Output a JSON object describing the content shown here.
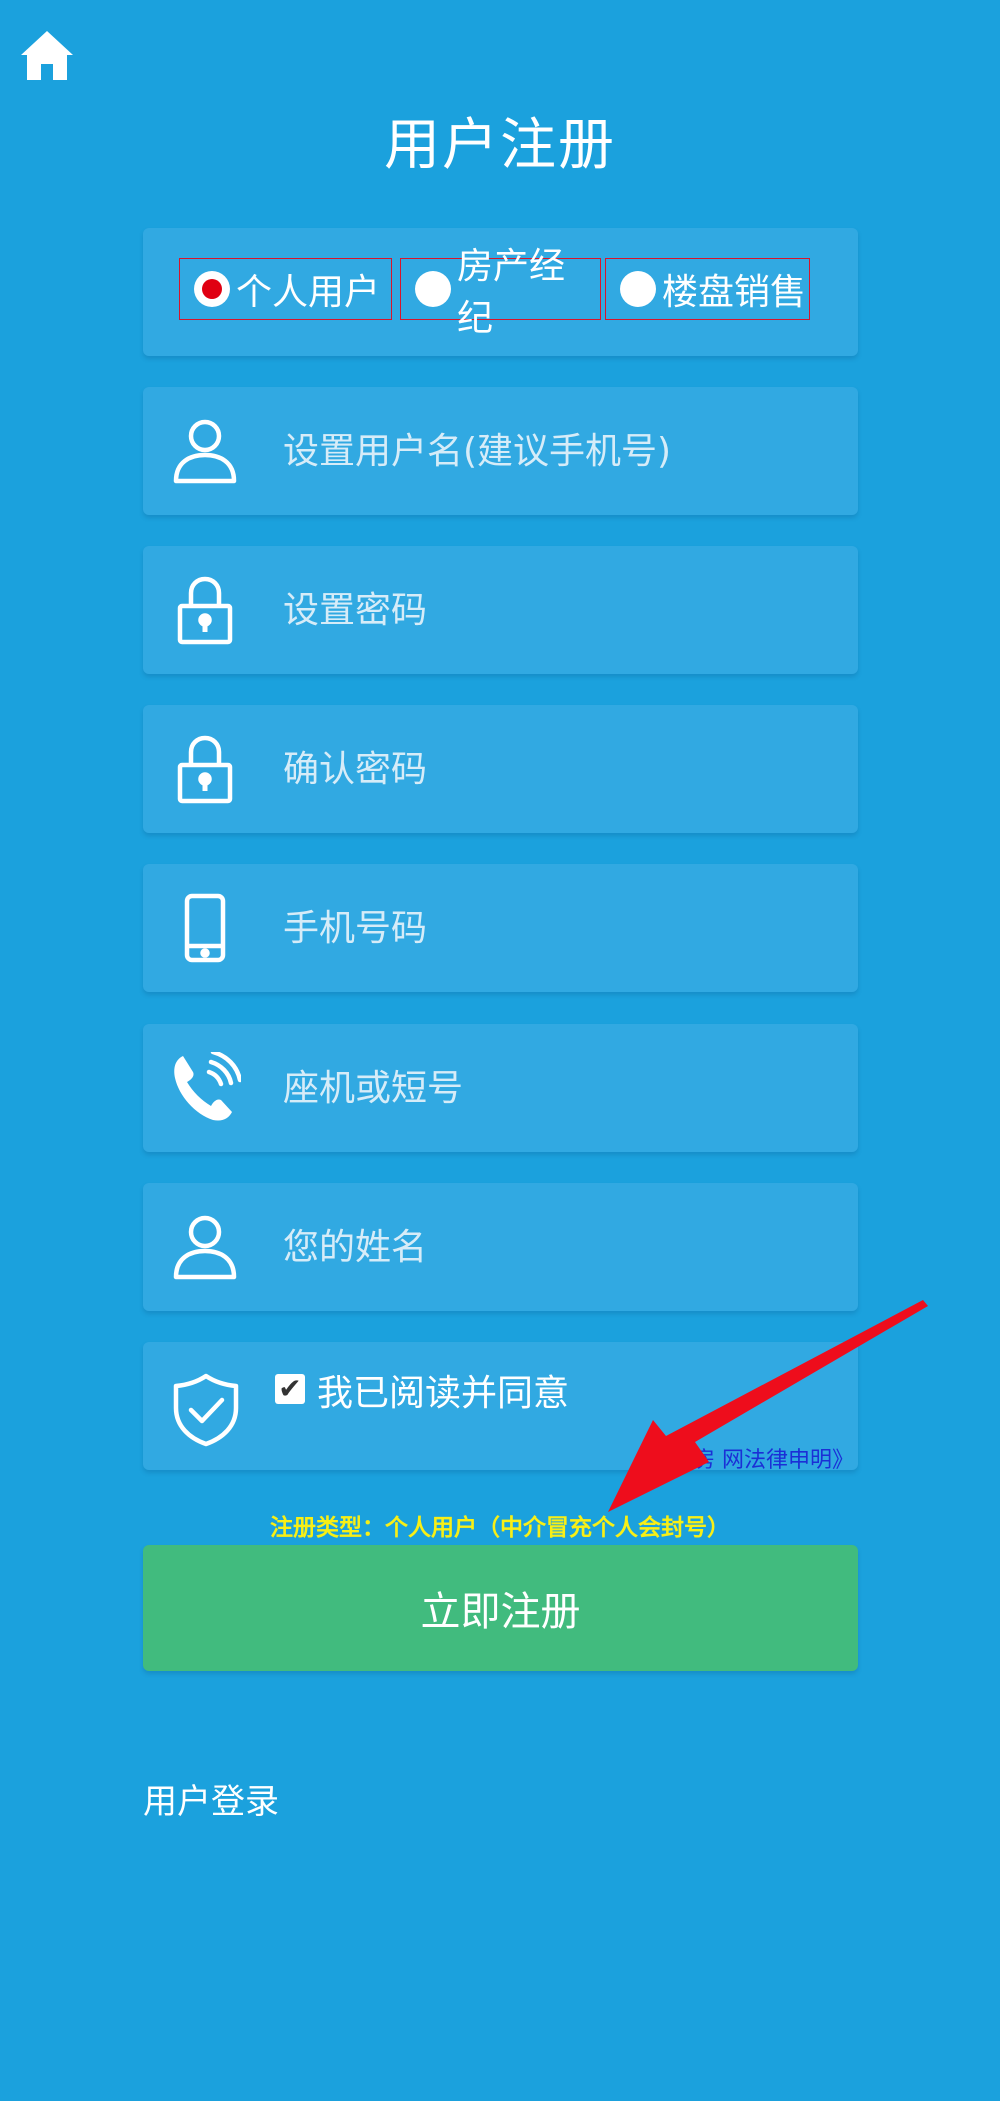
{
  "page": {
    "title": "用户注册"
  },
  "icons": {
    "home": "home-icon",
    "user": "user-icon",
    "lock": "lock-icon",
    "phone": "phone-icon",
    "landline": "landline-phone-icon",
    "shield": "shield-check-icon"
  },
  "user_types": [
    {
      "label": "个人用户",
      "selected": true
    },
    {
      "label": "房产经纪",
      "selected": false
    },
    {
      "label": "楼盘销售",
      "selected": false
    }
  ],
  "fields": {
    "username": {
      "placeholder": "设置用户名(建议手机号)",
      "value": ""
    },
    "password": {
      "placeholder": "设置密码",
      "value": ""
    },
    "confirm_password": {
      "placeholder": "确认密码",
      "value": ""
    },
    "mobile": {
      "placeholder": "手机号码",
      "value": ""
    },
    "landline": {
      "placeholder": "座机或短号",
      "value": ""
    },
    "name": {
      "placeholder": "您的姓名",
      "value": ""
    }
  },
  "agreement": {
    "label": "我已阅读并同意",
    "checked": true,
    "link_text": "《海莆房 网法律申明》"
  },
  "register_type_notice": "注册类型：个人用户（中介冒充个人会封号）",
  "submit_label": "立即注册",
  "login_link": "用户登录",
  "colors": {
    "background": "#1ba1dd",
    "field": "#31a9e2",
    "submit": "#41bb7e",
    "notice": "#f8ef16",
    "link": "#1b2fd6",
    "arrow": "#ee0d1c",
    "radio_selected": "#e00012"
  }
}
